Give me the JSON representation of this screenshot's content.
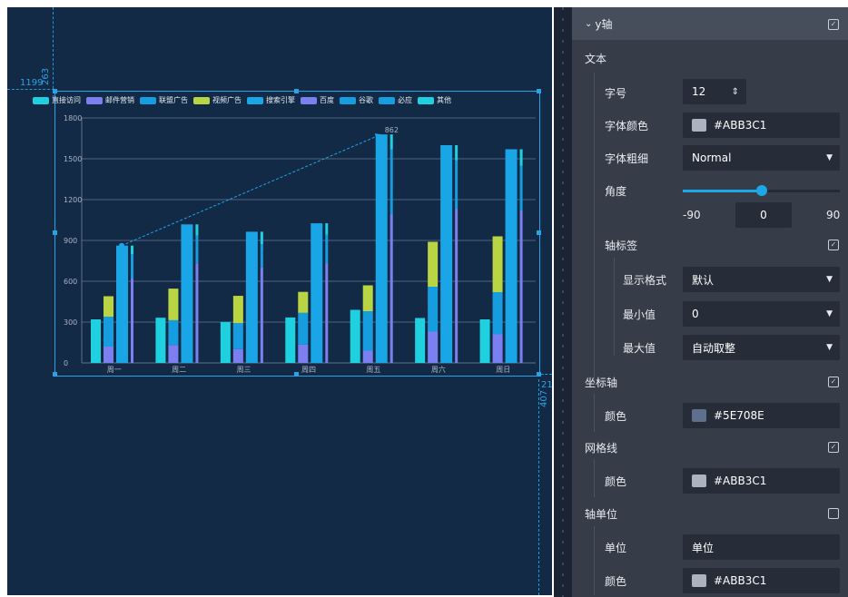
{
  "canvas": {
    "ruler_top": "263",
    "ruler_left": "1199",
    "ruler_right": "21",
    "ruler_bottom": "407"
  },
  "chart_data": {
    "type": "bar",
    "categories": [
      "周一",
      "周二",
      "周三",
      "周四",
      "周五",
      "周六",
      "周日"
    ],
    "ylim": [
      0,
      1800
    ],
    "yticks": [
      "1800",
      "1500",
      "1200",
      "900",
      "600",
      "300",
      "0"
    ],
    "legend": [
      "直接访问",
      "邮件营销",
      "联盟广告",
      "视频广告",
      "搜索引擎",
      "百度",
      "谷歌",
      "必应",
      "其他"
    ],
    "legend_colors": [
      "#1fd1e0",
      "#7b7ff0",
      "#169de0",
      "#b9d544",
      "#1aa5e6",
      "#7b7ff0",
      "#169de0",
      "#169de0",
      "#1fd1e0"
    ],
    "series": [
      {
        "name": "直接访问",
        "values": [
          320,
          332,
          301,
          334,
          390,
          330,
          320
        ]
      },
      {
        "name": "邮件营销",
        "values": [
          120,
          132,
          101,
          134,
          90,
          230,
          210
        ]
      },
      {
        "name": "联盟广告",
        "values": [
          220,
          182,
          191,
          234,
          290,
          330,
          310
        ]
      },
      {
        "name": "视频广告",
        "values": [
          150,
          232,
          201,
          154,
          190,
          330,
          410
        ]
      },
      {
        "name": "搜索引擎",
        "values": [
          862,
          1018,
          964,
          1026,
          1679,
          1600,
          1570
        ]
      },
      {
        "name": "百度",
        "values": [
          620,
          732,
          701,
          734,
          1090,
          1130,
          1120
        ]
      },
      {
        "name": "谷歌",
        "values": [
          120,
          132,
          101,
          134,
          290,
          230,
          220
        ]
      },
      {
        "name": "必应",
        "values": [
          60,
          72,
          71,
          74,
          190,
          130,
          110
        ]
      },
      {
        "name": "其他",
        "values": [
          62,
          82,
          91,
          84,
          109,
          110,
          120
        ]
      }
    ],
    "markline": {
      "value": "862",
      "from": 862,
      "to": 1679
    },
    "grid": true
  },
  "panel": {
    "section_title": "y轴",
    "text_group": "文本",
    "font_size_label": "字号",
    "font_size_value": "12",
    "font_color_label": "字体颜色",
    "font_color_value": "#ABB3C1",
    "font_color_hex": "#ABB3C1",
    "font_weight_label": "字体粗细",
    "font_weight_value": "Normal",
    "angle_label": "角度",
    "angle_min": "-90",
    "angle_value": "0",
    "angle_max": "90",
    "angle_fraction": 0.5,
    "axis_label_group": "轴标签",
    "display_format_label": "显示格式",
    "display_format_value": "默认",
    "min_label": "最小值",
    "min_value": "0",
    "max_label": "最大值",
    "max_value": "自动取整",
    "axis_line_group": "坐标轴",
    "axis_color_label": "颜色",
    "axis_color_value": "#5E708E",
    "axis_color_hex": "#5E708E",
    "gridline_group": "网格线",
    "grid_color_label": "颜色",
    "grid_color_value": "#ABB3C1",
    "grid_color_hex": "#ABB3C1",
    "axis_unit_group": "轴单位",
    "unit_label": "单位",
    "unit_value": "单位",
    "unit_color_label": "颜色",
    "unit_color_value": "#ABB3C1",
    "unit_color_hex": "#ABB3C1"
  }
}
